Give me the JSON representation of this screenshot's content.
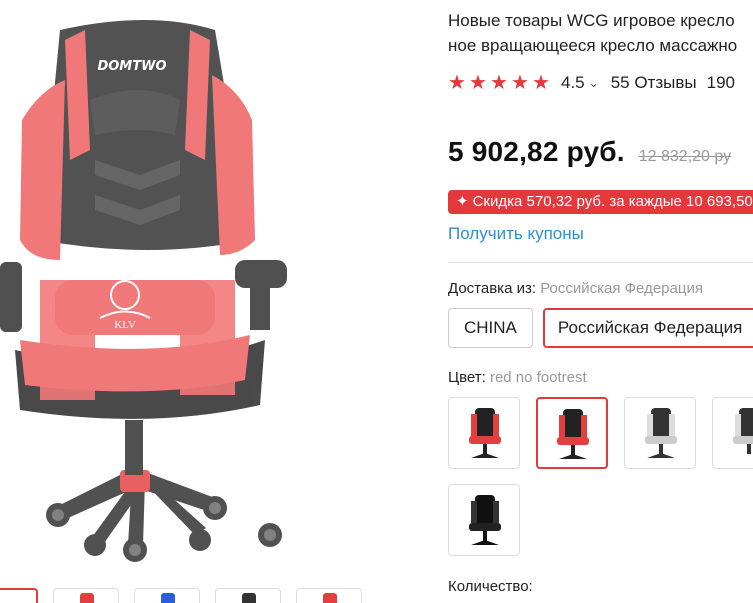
{
  "product": {
    "title_line1": "Новые товары WCG игровое кресло",
    "title_line2": "ное вращающееся кресло массажно"
  },
  "rating": {
    "value": "4.5",
    "stars": 5,
    "reviews_text": "55 Отзывы",
    "orders_text": "190"
  },
  "price": {
    "current": "5 902,82 руб.",
    "old": "12 832,20 ру"
  },
  "discount": {
    "text": "Скидка 570,32 руб. за каждые 10 693,50"
  },
  "coupons": {
    "link_text": "Получить купоны"
  },
  "shipping": {
    "label": "Доставка из:",
    "selected_value": "Российская Федерация",
    "options": [
      "CHINA",
      "Российская Федерация"
    ]
  },
  "color": {
    "label": "Цвет:",
    "selected_value": "red no footrest",
    "swatches": [
      "red-footrest",
      "red-no-footrest",
      "white-footrest",
      "white-no-footrest",
      "black"
    ]
  },
  "quantity": {
    "label": "Количество:"
  },
  "main_image": {
    "logo_text": "DOMTWO",
    "emblem_text": "KLV"
  },
  "colors": {
    "accent": "#e4393c",
    "link": "#2f8fcf",
    "star": "#e4393c",
    "chair_red": "#ef6a6a",
    "chair_black": "#333333"
  }
}
